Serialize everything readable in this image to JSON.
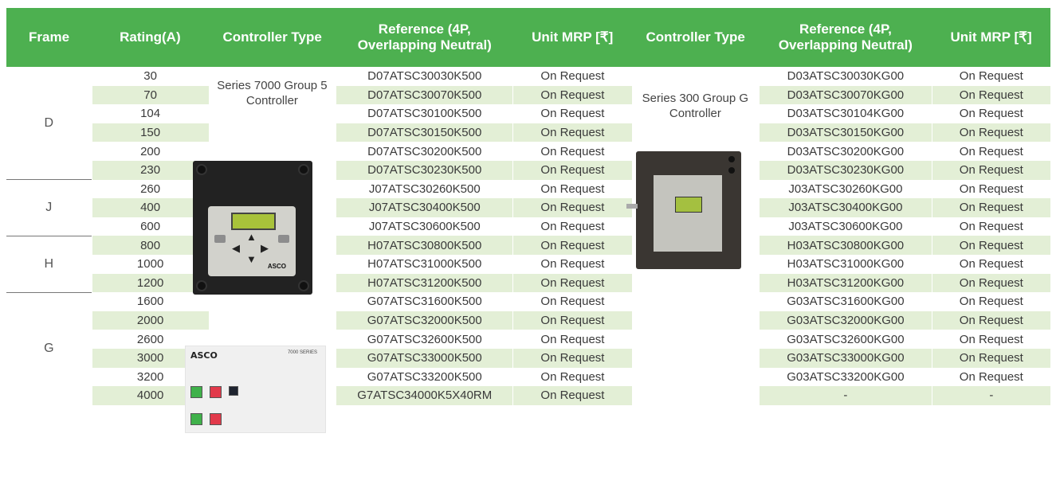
{
  "headers": [
    "Frame",
    "Rating(A)",
    "Controller Type",
    "Reference (4P, Overlapping Neutral)",
    "Unit MRP [₹]",
    "Controller Type",
    "Reference (4P, Overlapping Neutral)",
    "Unit MRP [₹]"
  ],
  "controllers": {
    "series7000": "Series 7000 Group 5 Controller",
    "series300": "Series 300 Group G Controller"
  },
  "frames": [
    "D",
    "J",
    "H",
    "G"
  ],
  "rows": [
    {
      "rating": "30",
      "ref1": "D07ATSC30030K500",
      "mrp1": "On Request",
      "ref2": "D03ATSC30030KG00",
      "mrp2": "On Request"
    },
    {
      "rating": "70",
      "ref1": "D07ATSC30070K500",
      "mrp1": "On Request",
      "ref2": "D03ATSC30070KG00",
      "mrp2": "On Request"
    },
    {
      "rating": "104",
      "ref1": "D07ATSC30100K500",
      "mrp1": "On Request",
      "ref2": "D03ATSC30104KG00",
      "mrp2": "On Request"
    },
    {
      "rating": "150",
      "ref1": "D07ATSC30150K500",
      "mrp1": "On Request",
      "ref2": "D03ATSC30150KG00",
      "mrp2": "On Request"
    },
    {
      "rating": "200",
      "ref1": "D07ATSC30200K500",
      "mrp1": "On Request",
      "ref2": "D03ATSC30200KG00",
      "mrp2": "On Request"
    },
    {
      "rating": "230",
      "ref1": "D07ATSC30230K500",
      "mrp1": "On Request",
      "ref2": "D03ATSC30230KG00",
      "mrp2": "On Request"
    },
    {
      "rating": "260",
      "ref1": "J07ATSC30260K500",
      "mrp1": "On Request",
      "ref2": "J03ATSC30260KG00",
      "mrp2": "On Request"
    },
    {
      "rating": "400",
      "ref1": "J07ATSC30400K500",
      "mrp1": "On Request",
      "ref2": "J03ATSC30400KG00",
      "mrp2": "On Request"
    },
    {
      "rating": "600",
      "ref1": "J07ATSC30600K500",
      "mrp1": "On Request",
      "ref2": "J03ATSC30600KG00",
      "mrp2": "On Request"
    },
    {
      "rating": "800",
      "ref1": "H07ATSC30800K500",
      "mrp1": "On Request",
      "ref2": "H03ATSC30800KG00",
      "mrp2": "On Request"
    },
    {
      "rating": "1000",
      "ref1": "H07ATSC31000K500",
      "mrp1": "On Request",
      "ref2": "H03ATSC31000KG00",
      "mrp2": "On Request"
    },
    {
      "rating": "1200",
      "ref1": "H07ATSC31200K500",
      "mrp1": "On Request",
      "ref2": "H03ATSC31200KG00",
      "mrp2": "On Request"
    },
    {
      "rating": "1600",
      "ref1": "G07ATSC31600K500",
      "mrp1": "On Request",
      "ref2": "G03ATSC31600KG00",
      "mrp2": "On Request"
    },
    {
      "rating": "2000",
      "ref1": "G07ATSC32000K500",
      "mrp1": "On Request",
      "ref2": "G03ATSC32000KG00",
      "mrp2": "On Request"
    },
    {
      "rating": "2600",
      "ref1": "G07ATSC32600K500",
      "mrp1": "On Request",
      "ref2": "G03ATSC32600KG00",
      "mrp2": "On Request"
    },
    {
      "rating": "3000",
      "ref1": "G07ATSC33000K500",
      "mrp1": "On Request",
      "ref2": "G03ATSC33000KG00",
      "mrp2": "On Request"
    },
    {
      "rating": "3200",
      "ref1": "G07ATSC33200K500",
      "mrp1": "On Request",
      "ref2": "G03ATSC33200KG00",
      "mrp2": "On Request"
    },
    {
      "rating": "4000",
      "ref1": "G7ATSC34000K5X40RM",
      "mrp1": "On Request",
      "ref2": "-",
      "mrp2": "-"
    }
  ],
  "image_text": {
    "asco_small": "ASCO",
    "ats_brand": "ASCO",
    "ats_model": "7000 SERIES"
  },
  "colors": {
    "header_green": "#4db050",
    "row_shade": "#e3efd6"
  }
}
